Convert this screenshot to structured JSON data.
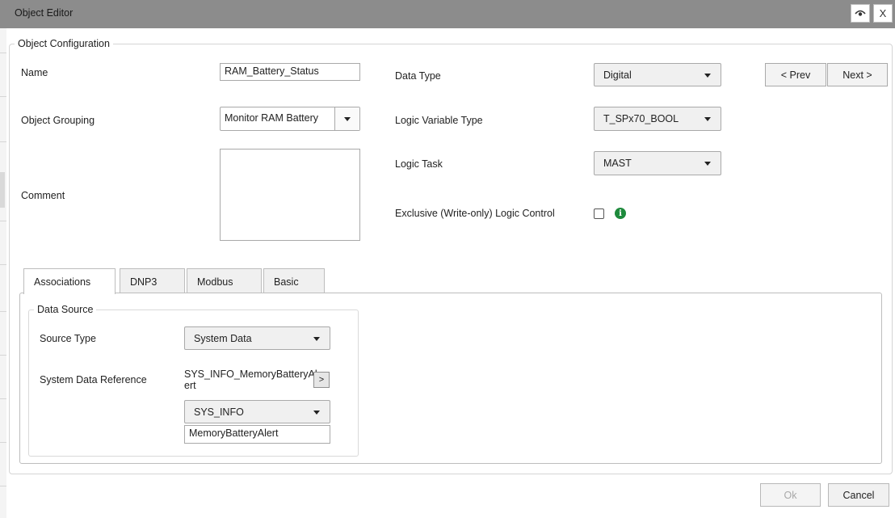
{
  "window": {
    "title": "Object Editor",
    "close_label": "X"
  },
  "config": {
    "legend": "Object Configuration",
    "name_label": "Name",
    "name_value": "RAM_Battery_Status",
    "grouping_label": "Object Grouping",
    "grouping_value": "Monitor RAM Battery",
    "comment_label": "Comment",
    "comment_value": "",
    "data_type_label": "Data Type",
    "data_type_value": "Digital",
    "logic_var_label": "Logic Variable Type",
    "logic_var_value": "T_SPx70_BOOL",
    "logic_task_label": "Logic Task",
    "logic_task_value": "MAST",
    "exclusive_label": "Exclusive (Write-only) Logic Control",
    "exclusive_checked": false,
    "prev_label": "< Prev",
    "next_label": "Next >"
  },
  "tabs": [
    {
      "label": "Associations",
      "active": true
    },
    {
      "label": "DNP3",
      "active": false
    },
    {
      "label": "Modbus",
      "active": false
    },
    {
      "label": "Basic",
      "active": false
    }
  ],
  "data_source": {
    "legend": "Data Source",
    "source_type_label": "Source Type",
    "source_type_value": "System Data",
    "sysref_label": "System Data Reference",
    "sysref_value_line1": "SYS_INFO_MemoryBatteryAl",
    "sysref_value_line2": "ert",
    "browse_label": ">",
    "category_value": "SYS_INFO",
    "item_value": "MemoryBatteryAlert"
  },
  "footer": {
    "ok_label": "Ok",
    "cancel_label": "Cancel"
  },
  "colors": {
    "titlebar": "#8c8c8c",
    "info_icon": "#1e8a3c"
  }
}
